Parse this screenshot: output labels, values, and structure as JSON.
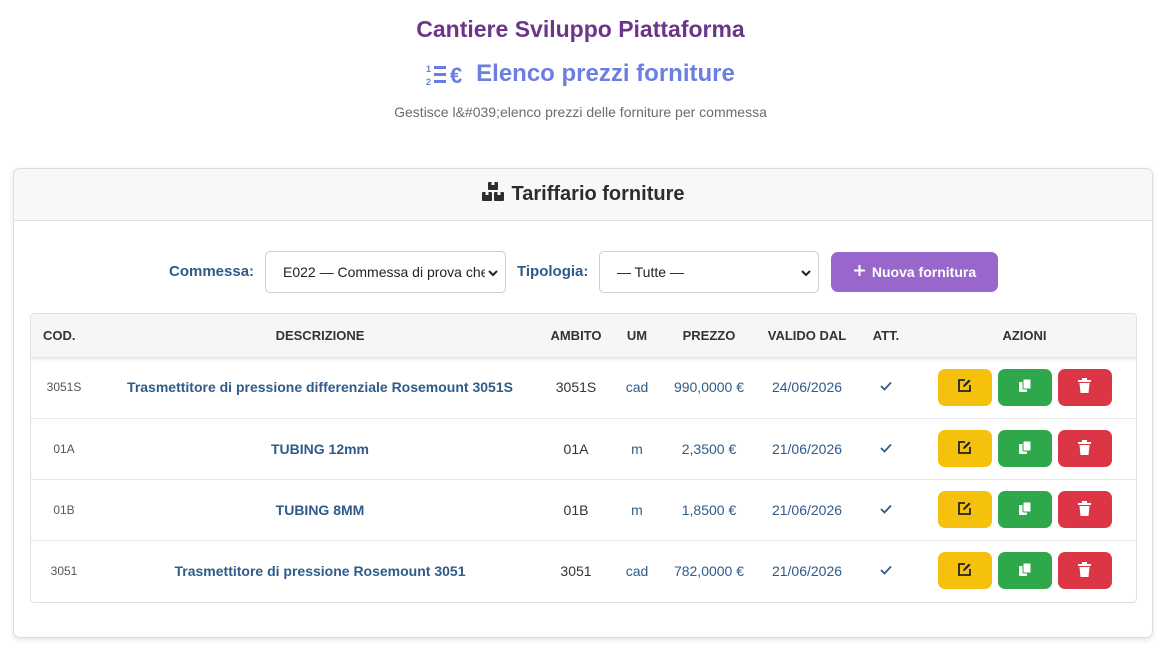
{
  "site": {
    "title": "Cantiere Sviluppo Piattaforma"
  },
  "page": {
    "title": "Elenco prezzi forniture",
    "title_icon": "price-list-euro-icon",
    "subtitle": "Gestisce l&#039;elenco prezzi delle forniture per commessa"
  },
  "card": {
    "title": "Tariffario forniture",
    "title_icon": "boxes-icon"
  },
  "filters": {
    "commessa_label": "Commessa:",
    "commessa_value": "E022 — Commessa di prova che",
    "tipologia_label": "Tipologia:",
    "tipologia_value": "— Tutte —",
    "new_button_label": "Nuova fornitura"
  },
  "table": {
    "headers": {
      "cod": "COD.",
      "descrizione": "DESCRIZIONE",
      "ambito": "AMBITO",
      "um": "UM",
      "prezzo": "PREZZO",
      "valido_dal": "VALIDO DAL",
      "att": "ATT.",
      "azioni": "AZIONI"
    },
    "rows": [
      {
        "cod": "3051S",
        "descrizione": "Trasmettitore di pressione differenziale Rosemount 3051S",
        "ambito": "3051S",
        "um": "cad",
        "prezzo": "990,0000 €",
        "valido_dal": "24/06/2026",
        "att": "✓"
      },
      {
        "cod": "01A",
        "descrizione": "TUBING 12mm",
        "ambito": "01A",
        "um": "m",
        "prezzo": "2,3500 €",
        "valido_dal": "21/06/2026",
        "att": "✓"
      },
      {
        "cod": "01B",
        "descrizione": "TUBING 8MM",
        "ambito": "01B",
        "um": "m",
        "prezzo": "1,8500 €",
        "valido_dal": "21/06/2026",
        "att": "✓"
      },
      {
        "cod": "3051",
        "descrizione": "Trasmettitore di pressione Rosemount 3051",
        "ambito": "3051",
        "um": "cad",
        "prezzo": "782,0000 €",
        "valido_dal": "21/06/2026",
        "att": "✓"
      }
    ]
  },
  "colors": {
    "site_title": "#6b3589",
    "page_title": "#6a7fe0",
    "label": "#2f5b8a",
    "primary_button": "#9966cc",
    "edit": "#f5c10c",
    "copy": "#2ea84a",
    "delete": "#dc3545"
  }
}
